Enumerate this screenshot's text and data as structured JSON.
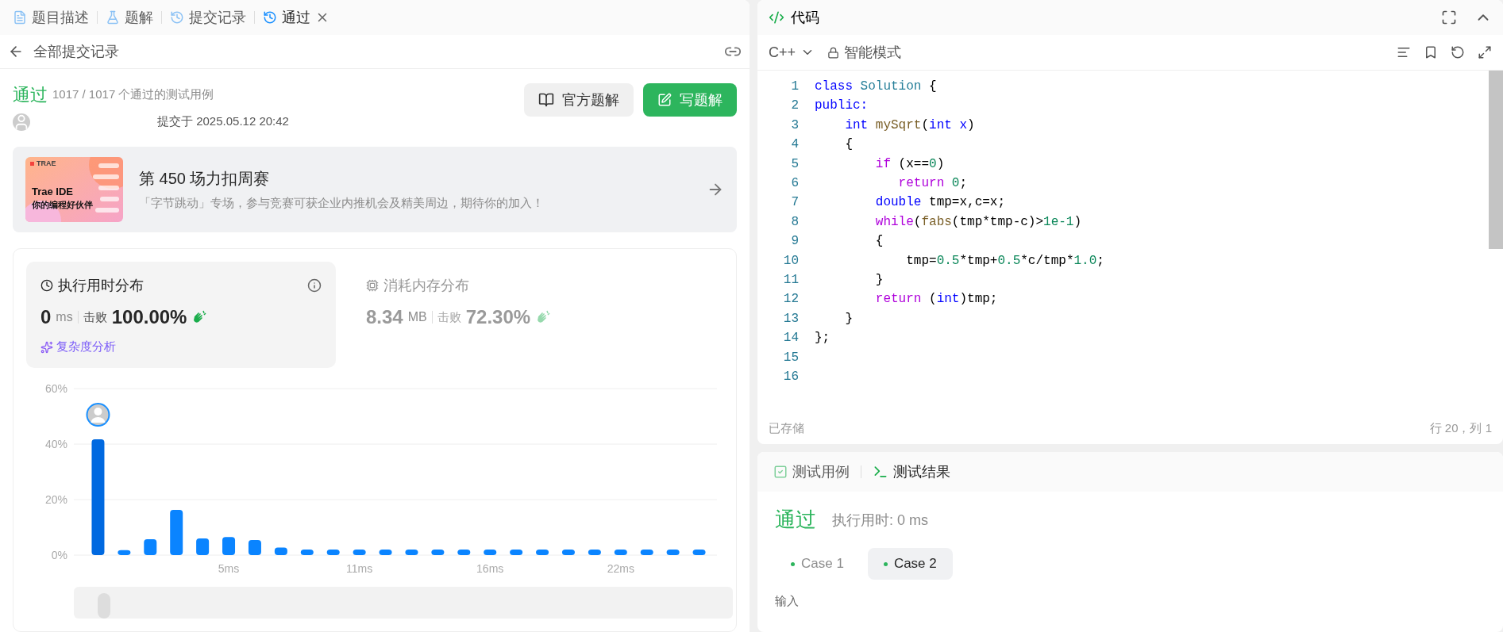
{
  "left_tabs": [
    {
      "label": "题目描述",
      "selected": false,
      "closable": false
    },
    {
      "label": "题解",
      "selected": false,
      "closable": false
    },
    {
      "label": "提交记录",
      "selected": false,
      "closable": false
    },
    {
      "label": "通过",
      "selected": true,
      "closable": true
    }
  ],
  "sub_header": {
    "title": "全部提交记录"
  },
  "result": {
    "status": "通过",
    "cases": "1017 / 1017 个通过的测试用例",
    "submitted": "提交于 2025.05.12 20:42",
    "buttons": [
      {
        "label": "官方题解",
        "kind": "secondary"
      },
      {
        "label": "写题解",
        "kind": "primary"
      }
    ]
  },
  "banner": {
    "brand": "TRAE",
    "image_title": "Trae IDE",
    "image_subtitle": "你的编程好伙伴",
    "title": "第 450 场力扣周赛",
    "description": "「字节跳动」专场，参与竞赛可获企业内推机会及精美周边，期待你的加入！"
  },
  "stats": [
    {
      "title": "执行用时分布",
      "selected": true,
      "value": "0",
      "unit": "ms",
      "beat_label": "击败",
      "beat": "100.00%",
      "link": "复杂度分析"
    },
    {
      "title": "消耗内存分布",
      "selected": false,
      "value": "8.34",
      "unit": "MB",
      "beat_label": "击败",
      "beat": "72.30%"
    }
  ],
  "distribution": {
    "chart_data": {
      "type": "bar",
      "categories": [
        null,
        null,
        null,
        null,
        null,
        "5ms",
        null,
        null,
        null,
        null,
        "11ms",
        null,
        null,
        null,
        null,
        "16ms",
        null,
        null,
        null,
        null,
        "22ms",
        null,
        null,
        null
      ],
      "values": [
        41.7,
        1.8,
        5.7,
        16.3,
        6,
        6.5,
        5.4,
        2.7,
        2,
        2,
        2,
        2,
        2,
        2,
        2,
        2,
        2,
        2,
        2,
        2,
        2,
        2,
        2,
        2
      ],
      "ylim": [
        0,
        60
      ],
      "yticks": [
        {
          "value": 0,
          "label": "0%"
        },
        {
          "value": 20,
          "label": "20%"
        },
        {
          "value": 40,
          "label": "40%"
        },
        {
          "value": 60,
          "label": "60%"
        }
      ]
    }
  },
  "editor": {
    "title": "代码",
    "language": "C++",
    "mode": "智能模式",
    "saved": "已存储",
    "cursor": "行 20，列 1",
    "lines": [
      {
        "number": "1",
        "tokens": [
          {
            "t": "class ",
            "color": "#0000ff"
          },
          {
            "t": "Solution",
            "color": "#267f99"
          },
          {
            "t": " {",
            "color": "#000000"
          }
        ]
      },
      {
        "number": "2",
        "tokens": [
          {
            "t": "public:",
            "color": "#0000ff"
          }
        ]
      },
      {
        "number": "3",
        "tokens": [
          {
            "t": "    int ",
            "color": "#0000ff"
          },
          {
            "t": "mySqrt",
            "color": "#795e26"
          },
          {
            "t": "(",
            "color": "#000000"
          },
          {
            "t": "int x",
            "color": "#0000ff"
          },
          {
            "t": ")",
            "color": "#000000"
          }
        ]
      },
      {
        "number": "4",
        "tokens": [
          {
            "t": "    {",
            "color": "#000000"
          }
        ]
      },
      {
        "number": "5",
        "tokens": [
          {
            "t": "        if",
            "color": "#af00db"
          },
          {
            "t": " (x==",
            "color": "#000000"
          },
          {
            "t": "0",
            "color": "#098658"
          },
          {
            "t": ")",
            "color": "#000000"
          }
        ]
      },
      {
        "number": "6",
        "tokens": [
          {
            "t": "           return ",
            "color": "#af00db"
          },
          {
            "t": "0",
            "color": "#098658"
          },
          {
            "t": ";",
            "color": "#000000"
          }
        ]
      },
      {
        "number": "7",
        "tokens": [
          {
            "t": "        double",
            "color": "#0000ff"
          },
          {
            "t": " tmp=x,c=x;",
            "color": "#000000"
          }
        ]
      },
      {
        "number": "8",
        "tokens": [
          {
            "t": "        while",
            "color": "#af00db"
          },
          {
            "t": "(",
            "color": "#000000"
          },
          {
            "t": "fabs",
            "color": "#795e26"
          },
          {
            "t": "(tmp*tmp-c)>",
            "color": "#000000"
          },
          {
            "t": "1e-1",
            "color": "#098658"
          },
          {
            "t": ")",
            "color": "#000000"
          }
        ]
      },
      {
        "number": "9",
        "tokens": [
          {
            "t": "        {",
            "color": "#000000"
          }
        ]
      },
      {
        "number": "10",
        "tokens": [
          {
            "t": "            tmp=",
            "color": "#000000"
          },
          {
            "t": "0.5",
            "color": "#098658"
          },
          {
            "t": "*tmp+",
            "color": "#000000"
          },
          {
            "t": "0.5",
            "color": "#098658"
          },
          {
            "t": "*c/tmp*",
            "color": "#000000"
          },
          {
            "t": "1.0",
            "color": "#098658"
          },
          {
            "t": ";",
            "color": "#000000"
          }
        ]
      },
      {
        "number": "11",
        "tokens": [
          {
            "t": "        }",
            "color": "#000000"
          }
        ]
      },
      {
        "number": "12",
        "tokens": [
          {
            "t": "        return",
            "color": "#af00db"
          },
          {
            "t": " (",
            "color": "#000000"
          },
          {
            "t": "int",
            "color": "#0000ff"
          },
          {
            "t": ")tmp;",
            "color": "#000000"
          }
        ]
      },
      {
        "number": "13",
        "tokens": [
          {
            "t": "    }",
            "color": "#000000"
          }
        ]
      },
      {
        "number": "14",
        "tokens": [
          {
            "t": "};",
            "color": "#000000"
          }
        ]
      },
      {
        "number": "15"
      },
      {
        "number": "16"
      }
    ]
  },
  "test_panel": {
    "tabs": [
      {
        "label": "测试用例",
        "selected": false
      },
      {
        "label": "测试结果",
        "selected": true
      }
    ],
    "status": "通过",
    "runtime": "执行用时: 0 ms",
    "cases": [
      {
        "label": "Case 1",
        "selected": false
      },
      {
        "label": "Case 2",
        "selected": true
      }
    ],
    "input_label": "输入"
  }
}
